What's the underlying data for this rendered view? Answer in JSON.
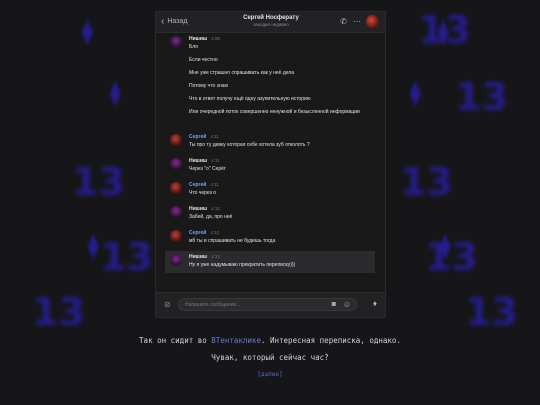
{
  "colors": {
    "background": "#161618",
    "window": "#19191a",
    "accent": "#71aaeb",
    "decor": "#2a1fb0"
  },
  "header": {
    "back_label": "Назад",
    "contact_name": "Сергей Носферату",
    "contact_status": "заходил недавно",
    "icons": [
      "chevron-left-icon",
      "phone-icon",
      "more-icon",
      "avatar"
    ]
  },
  "decor": {
    "number": "13"
  },
  "messages": [
    {
      "author": "Нишиш",
      "time": "4:08",
      "lines": [
        "Бля",
        "Если честно",
        "Мне уже страшно спрашивать как у неё дела",
        "Потому что знаю",
        "Что в ответ получу ещё одну азупительную историю",
        "Или очередной поток совершенно ненужной и безысленной информации"
      ]
    },
    {
      "author": "Сергей",
      "time": "4:11",
      "lines": [
        "Ты про ту девку которая себе хотела зуб отколоть ?"
      ]
    },
    {
      "author": "Нишиш",
      "time": "4:11",
      "lines": [
        "Через \"о\" Серёг"
      ]
    },
    {
      "author": "Сергей",
      "time": "4:11",
      "lines": [
        "Что через о"
      ]
    },
    {
      "author": "Нишиш",
      "time": "4:12",
      "lines": [
        "Забей, да, про неё"
      ]
    },
    {
      "author": "Сергей",
      "time": "4:12",
      "lines": [
        "мб ты и спрашивать не будешь тогда"
      ]
    },
    {
      "author": "Нишиш",
      "time": "4:13",
      "lines": [
        "Ну я уже надумываю прекратить переписку)))"
      ]
    }
  ],
  "input": {
    "placeholder": "Напишите сообщение..."
  },
  "caption": {
    "line1_pre": "Так он сидит во ",
    "line1_link": "ВТентаклике",
    "line1_post": ". Интересная переписка, однако.",
    "line2": "Чувак, который сейчас час?",
    "next_label": "[далее]"
  }
}
